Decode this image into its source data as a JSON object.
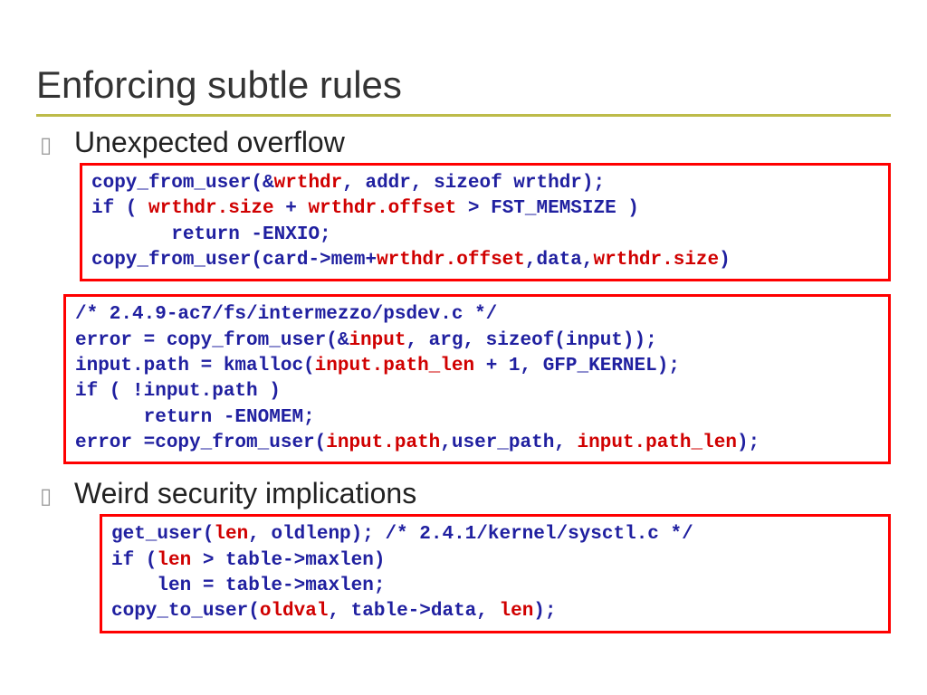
{
  "title": "Enforcing subtle rules",
  "bullets": {
    "b1": "Unexpected overflow",
    "b2": "Weird security implications"
  },
  "code1": {
    "l1a": "copy_from_user(&",
    "l1b": "wrthdr",
    "l1c": ", addr, sizeof wrthdr);",
    "l2a": "if ( ",
    "l2b": "wrthdr.size",
    "l2c": " + ",
    "l2d": "wrthdr.offset",
    "l2e": " > FST_MEMSIZE )",
    "l3": "       return -ENXIO;",
    "l4a": "copy_from_user(card->mem+",
    "l4b": "wrthdr.offset",
    "l4c": ",data,",
    "l4d": "wrthdr.size",
    "l4e": ")"
  },
  "code2": {
    "l1": "/* 2.4.9-ac7/fs/intermezzo/psdev.c */",
    "l2a": "error = copy_from_user(&",
    "l2b": "input",
    "l2c": ", arg, sizeof(input));",
    "l3a": "input.path = kmalloc(",
    "l3b": "input.path_len",
    "l3c": " + 1, GFP_KERNEL);",
    "l4": "if ( !input.path )",
    "l5": "      return -ENOMEM;",
    "l6a": "error =copy_from_user(",
    "l6b": "input.path",
    "l6c": ",user_path, ",
    "l6d": "input.path_len",
    "l6e": ");"
  },
  "code3": {
    "l1a": "get_user(",
    "l1b": "len",
    "l1c": ", oldlenp); /* 2.4.1/kernel/sysctl.c */",
    "l2a": "if (",
    "l2b": "len",
    "l2c": " > table->maxlen)",
    "l3": "    len = table->maxlen;",
    "l4a": "copy_to_user(",
    "l4b": "oldval",
    "l4c": ", table->data, ",
    "l4d": "len",
    "l4e": ");"
  }
}
